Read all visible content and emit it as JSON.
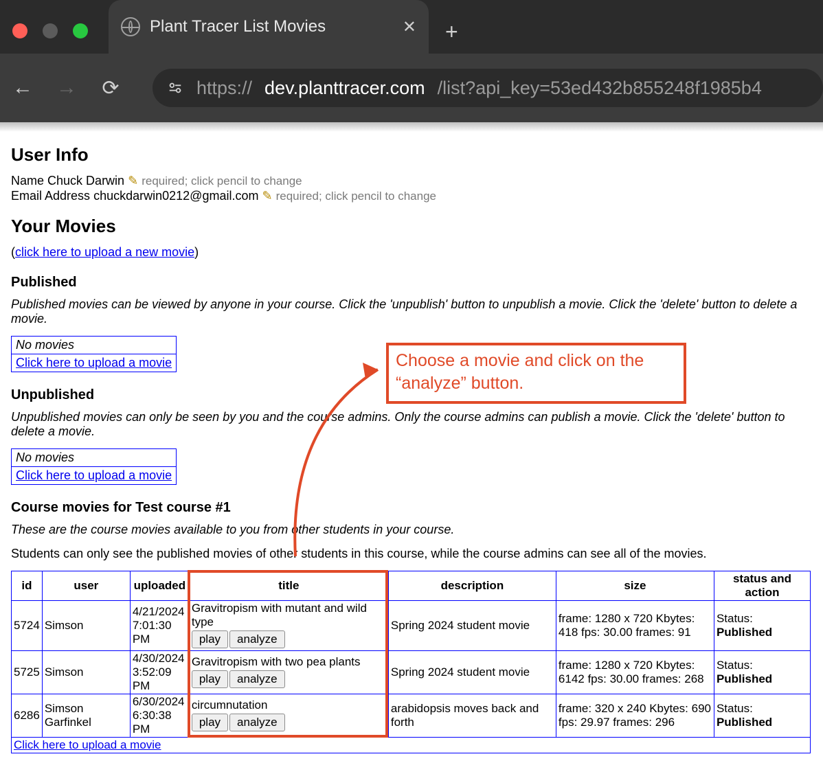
{
  "browser": {
    "tab_title": "Plant Tracer List Movies",
    "url_scheme": "https://",
    "url_domain": "dev.planttracer.com",
    "url_path": "/list?api_key=53ed432b855248f1985b4"
  },
  "user_info": {
    "heading": "User Info",
    "name_label": "Name",
    "name_value": "Chuck Darwin",
    "email_label": "Email Address",
    "email_value": "chuckdarwin0212@gmail.com",
    "helper": "required; click pencil to change"
  },
  "your_movies": {
    "heading": "Your Movies",
    "upload_pre": "(",
    "upload_link": "click here to upload a new movie",
    "upload_post": ")"
  },
  "published": {
    "heading": "Published",
    "desc": "Published movies can be viewed by anyone in your course. Click the 'unpublish' button to unpublish a movie. Click the 'delete' button to delete a movie.",
    "no_movies": "No movies",
    "upload_link": "Click here to upload a movie"
  },
  "unpublished": {
    "heading": "Unpublished",
    "desc": "Unpublished movies can only be seen by you and the course admins. Only the course admins can publish a movie. Click the 'delete' button to delete a movie.",
    "no_movies": "No movies",
    "upload_link": "Click here to upload a movie"
  },
  "course": {
    "heading": "Course movies for Test course #1",
    "desc_italic": "These are the course movies available to you from other students in your course.",
    "desc_normal": "Students can only see the published movies of other students in this course, while the course admins can see all of the movies."
  },
  "annotation": {
    "text": "Choose a movie and click on the “analyze” button."
  },
  "table": {
    "headers": {
      "id": "id",
      "user": "user",
      "uploaded": "uploaded",
      "title": "title",
      "description": "description",
      "size": "size",
      "status": "status and action"
    },
    "buttons": {
      "play": "play",
      "analyze": "analyze"
    },
    "status_prefix": "Status: ",
    "status_value": "Published",
    "rows": [
      {
        "id": "5724",
        "user": "Simson",
        "uploaded": "4/21/2024 7:01:30 PM",
        "title": "Gravitropism with mutant and wild type",
        "description": "Spring 2024 student movie",
        "size": "frame: 1280 x 720 Kbytes: 418 fps: 30.00 frames: 91"
      },
      {
        "id": "5725",
        "user": "Simson",
        "uploaded": "4/30/2024 3:52:09 PM",
        "title": "Gravitropism with two pea plants",
        "description": "Spring 2024 student movie",
        "size": "frame: 1280 x 720 Kbytes: 6142 fps: 30.00 frames: 268"
      },
      {
        "id": "6286",
        "user": "Simson Garfinkel",
        "uploaded": "6/30/2024 6:30:38 PM",
        "title": "circumnutation",
        "description": "arabidopsis moves back and forth",
        "size": "frame: 320 x 240 Kbytes: 690 fps: 29.97 frames: 296"
      }
    ],
    "footer_link": "Click here to upload a movie"
  }
}
